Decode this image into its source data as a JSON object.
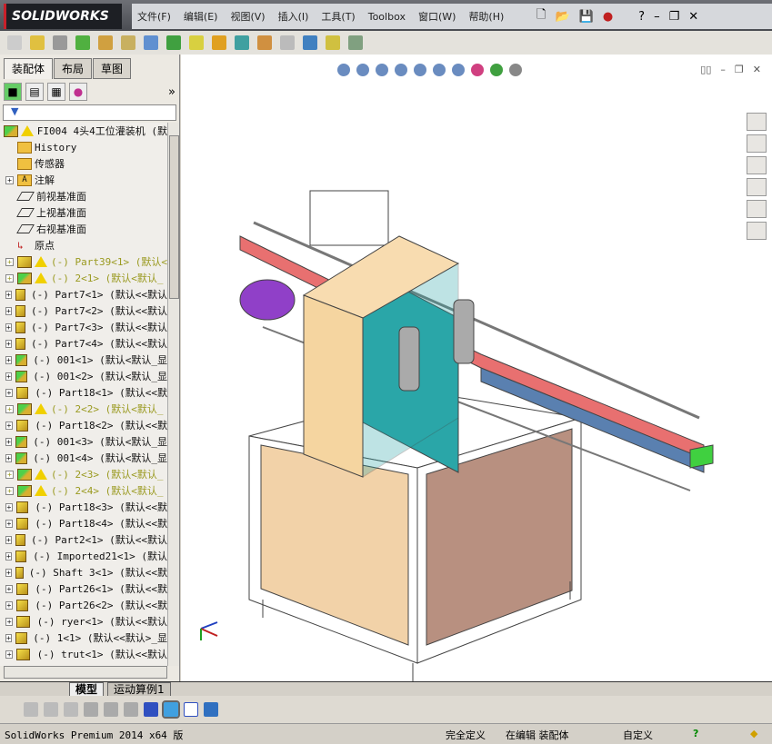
{
  "app": {
    "logo": "SOLIDWORKS"
  },
  "menu": [
    "文件(F)",
    "编辑(E)",
    "视图(V)",
    "插入(I)",
    "工具(T)",
    "Toolbox",
    "窗口(W)",
    "帮助(H)"
  ],
  "tabs": [
    "装配体",
    "布局",
    "草图"
  ],
  "tree": [
    {
      "label": "FI004 4头4工位灌装机 (默",
      "kind": "root",
      "warn": true
    },
    {
      "label": "History",
      "kind": "history"
    },
    {
      "label": "传感器",
      "kind": "sensor"
    },
    {
      "label": "注解",
      "kind": "annot",
      "expand": true
    },
    {
      "label": "前视基准面",
      "kind": "plane"
    },
    {
      "label": "上视基准面",
      "kind": "plane"
    },
    {
      "label": "右视基准面",
      "kind": "plane"
    },
    {
      "label": "原点",
      "kind": "origin"
    },
    {
      "label": "(-) Part39<1> (默认<",
      "kind": "part",
      "warn": true,
      "expand": true
    },
    {
      "label": "(-) 2<1> (默认<默认_",
      "kind": "asm",
      "warn": true,
      "expand": true
    },
    {
      "label": "(-) Part7<1> (默认<<默认",
      "kind": "part",
      "expand": true
    },
    {
      "label": "(-) Part7<2> (默认<<默认",
      "kind": "part",
      "expand": true
    },
    {
      "label": "(-) Part7<3> (默认<<默认",
      "kind": "part",
      "expand": true
    },
    {
      "label": "(-) Part7<4> (默认<<默认",
      "kind": "part",
      "expand": true
    },
    {
      "label": "(-) 001<1> (默认<默认_显",
      "kind": "asm",
      "expand": true
    },
    {
      "label": "(-) 001<2> (默认<默认_显",
      "kind": "asm",
      "expand": true
    },
    {
      "label": "(-) Part18<1> (默认<<默",
      "kind": "part",
      "expand": true
    },
    {
      "label": "(-) 2<2> (默认<默认_",
      "kind": "asm",
      "warn": true,
      "expand": true
    },
    {
      "label": "(-) Part18<2> (默认<<默",
      "kind": "part",
      "expand": true
    },
    {
      "label": "(-) 001<3> (默认<默认_显",
      "kind": "asm",
      "expand": true
    },
    {
      "label": "(-) 001<4> (默认<默认_显",
      "kind": "asm",
      "expand": true
    },
    {
      "label": "(-) 2<3> (默认<默认_",
      "kind": "asm",
      "warn": true,
      "expand": true
    },
    {
      "label": "(-) 2<4> (默认<默认_",
      "kind": "asm",
      "warn": true,
      "expand": true
    },
    {
      "label": "(-) Part18<3> (默认<<默",
      "kind": "part",
      "expand": true
    },
    {
      "label": "(-) Part18<4> (默认<<默",
      "kind": "part",
      "expand": true
    },
    {
      "label": "(-) Part2<1> (默认<<默认",
      "kind": "part",
      "expand": true
    },
    {
      "label": "(-) Imported21<1> (默认",
      "kind": "part",
      "expand": true
    },
    {
      "label": "(-) Shaft 3<1> (默认<<默",
      "kind": "part",
      "expand": true
    },
    {
      "label": "(-) Part26<1> (默认<<默",
      "kind": "part",
      "expand": true
    },
    {
      "label": "(-) Part26<2> (默认<<默",
      "kind": "part",
      "expand": true
    },
    {
      "label": "(-) ryer<1> (默认<<默认",
      "kind": "part",
      "expand": true
    },
    {
      "label": "(-) 1<1> (默认<<默认>_显",
      "kind": "part",
      "expand": true
    },
    {
      "label": "(-) trut<1> (默认<<默认",
      "kind": "part",
      "expand": true
    }
  ],
  "bottom_tabs": [
    "模型",
    "运动算例1"
  ],
  "status": {
    "product": "SolidWorks Premium 2014 x64 版",
    "state": "完全定义",
    "editing": "在编辑 装配体",
    "units": "自定义"
  },
  "colors": {
    "accent": "#c8202a",
    "beige": "#f5d5a0",
    "teal": "#2aa6a8",
    "purple": "#9040c8",
    "conveyor": "#e87070",
    "green": "#40d040"
  }
}
